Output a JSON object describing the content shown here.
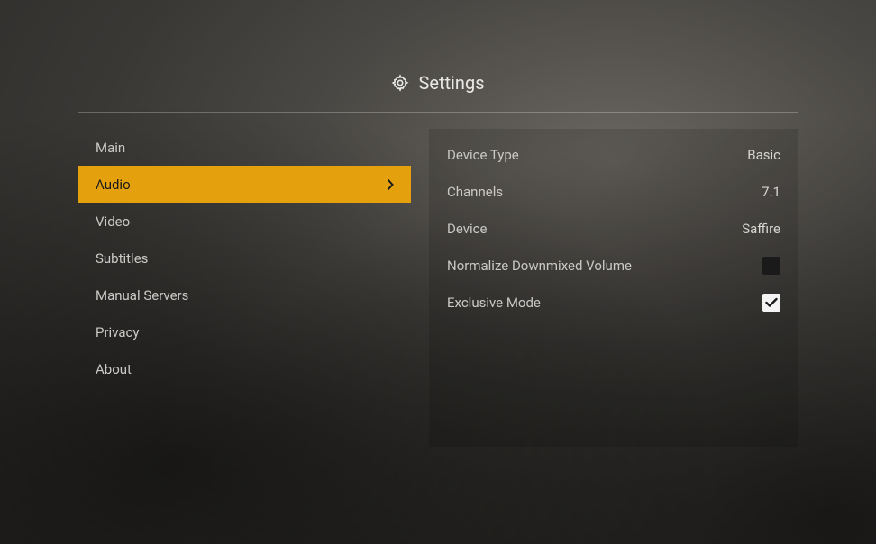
{
  "header": {
    "title": "Settings"
  },
  "sidebar": {
    "items": [
      {
        "label": "Main",
        "selected": false
      },
      {
        "label": "Audio",
        "selected": true
      },
      {
        "label": "Video",
        "selected": false
      },
      {
        "label": "Subtitles",
        "selected": false
      },
      {
        "label": "Manual Servers",
        "selected": false
      },
      {
        "label": "Privacy",
        "selected": false
      },
      {
        "label": "About",
        "selected": false
      }
    ]
  },
  "panel": {
    "rows": [
      {
        "label": "Device Type",
        "value": "Basic",
        "type": "value"
      },
      {
        "label": "Channels",
        "value": "7.1",
        "type": "value"
      },
      {
        "label": "Device",
        "value": "Saffire",
        "type": "value"
      },
      {
        "label": "Normalize Downmixed Volume",
        "checked": false,
        "type": "checkbox"
      },
      {
        "label": "Exclusive Mode",
        "checked": true,
        "type": "checkbox"
      }
    ]
  },
  "colors": {
    "accent": "#e5a00d"
  }
}
